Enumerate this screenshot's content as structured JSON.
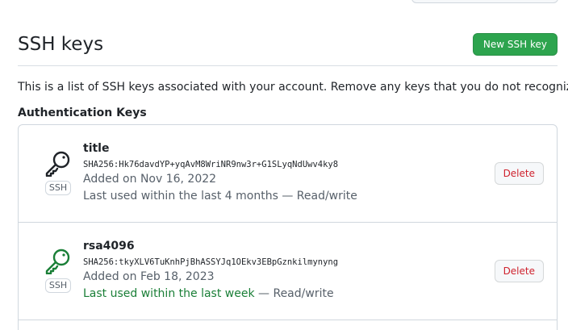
{
  "header": {
    "title": "SSH keys",
    "new_key_label": "New SSH key"
  },
  "intro_text": "This is a list of SSH keys associated with your account. Remove any keys that you do not recognize.",
  "section_title": "Authentication Keys",
  "colors": {
    "primary_green": "#2da44e",
    "danger_red": "#cf222e",
    "recent_green": "#1a7f37",
    "muted_text": "#57606a",
    "border": "#d0d7de"
  },
  "keys": [
    {
      "icon": "key-icon",
      "icon_color": "#1f2328",
      "type_label": "SSH",
      "title": "title",
      "fingerprint": "SHA256:Hk76davdYP+yqAvM8WriNR9nw3r+G1SLyqNdUwv4ky8",
      "added_on": "Added on Nov 16, 2022",
      "last_used": "Last used within the last 4 months",
      "last_used_recent": false,
      "separator": " — ",
      "access": "Read/write",
      "delete_label": "Delete"
    },
    {
      "icon": "key-icon",
      "icon_color": "#1a7f37",
      "type_label": "SSH",
      "title": "rsa4096",
      "fingerprint": "SHA256:tkyXLV6TuKnhPjBhASSYJq1OEkv3EBpGznkilmynyng",
      "added_on": "Added on Feb 18, 2023",
      "last_used": "Last used within the last week",
      "last_used_recent": true,
      "separator": " — ",
      "access": "Read/write",
      "delete_label": "Delete"
    }
  ]
}
